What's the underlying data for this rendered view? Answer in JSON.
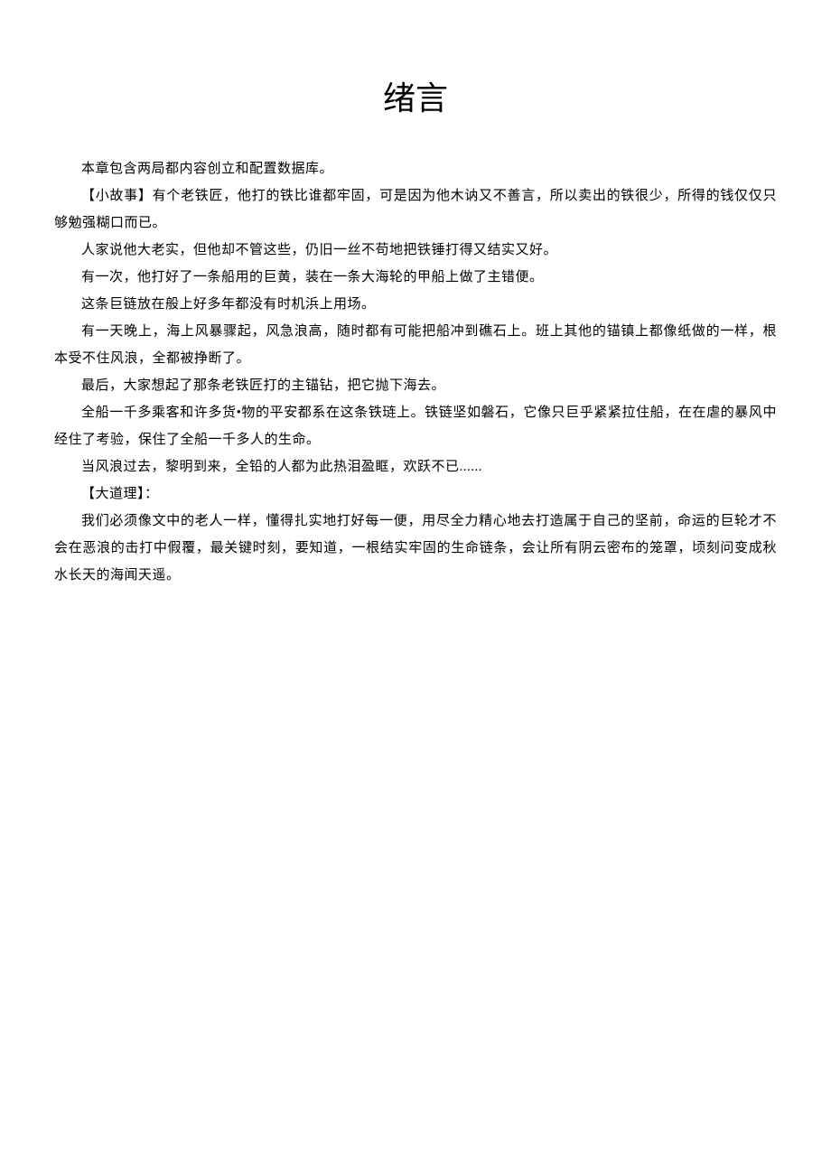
{
  "title": "绪言",
  "paragraphs": [
    "本章包含两局都内容创立和配置数据库。",
    "【小故事】有个老铁匠，他打的铁比谁都牢固，可是因为他木讷又不善言，所以卖出的铁很少，所得的钱仅仅只够勉强糊口而已。",
    "人家说他大老实，但他却不管这些，仍旧一丝不苟地把铁锤打得又结实又好。",
    "有一次，他打好了一条船用的巨黄，装在一条大海轮的甲船上做了主错便。",
    "这条巨链放在般上好多年都没有时机浜上用场。",
    "有一天晚上，海上风暴骤起，风急浪高，随时都有可能把船冲到礁石上。班上其他的锚镇上都像纸做的一样，根本受不住风浪，全都被挣断了。",
    "最后，大家想起了那条老铁匠打的主锚钻，把它抛下海去。",
    "全船一千多乘客和许多货•物的平安都系在这条铁琏上。铁链坚如磐石，它像只巨乎紧紧拉住船，在在虐的暴风中经住了考验，保住了全船一千多人的生命。",
    "当风浪过去，黎明到来，全铅的人都为此热泪盈眶，欢跃不已......",
    "【大道理】：",
    " 我们必须像文中的老人一样，懂得扎实地打好每一便，用尽全力精心地去打造属于自己的坚前，命运的巨轮才不会在恶浪的击打中假覆，最关键时刻，要知道，一根结实牢固的生命链条，会让所有阴云密布的笼罩，顷刻问变成秋水长天的海闻天遥。"
  ]
}
